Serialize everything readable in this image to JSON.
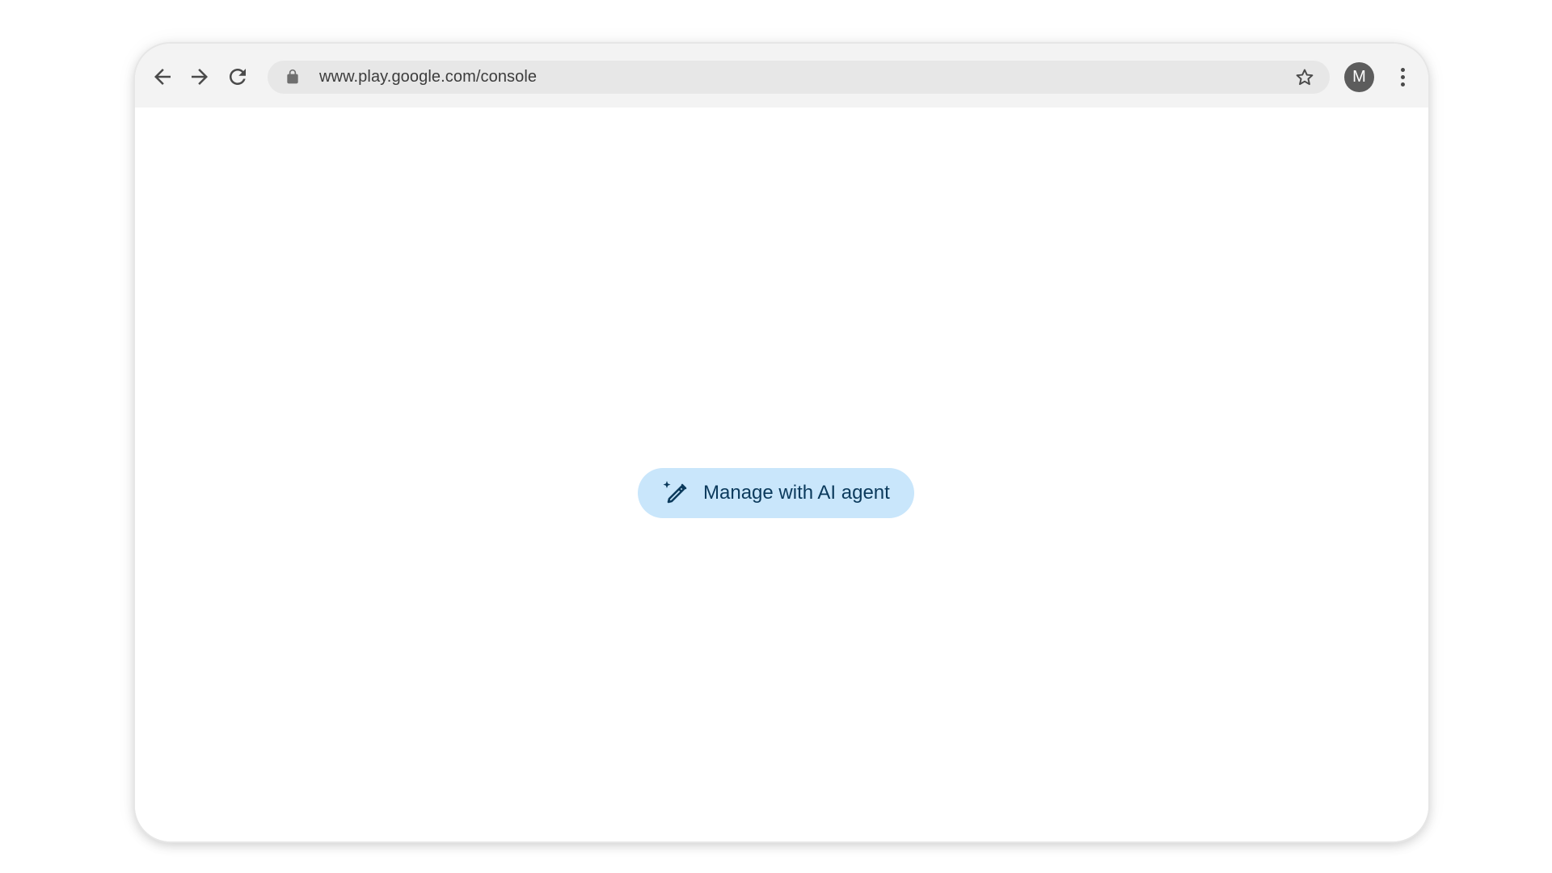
{
  "browser": {
    "url": "www.play.google.com/console",
    "profile_initial": "M"
  },
  "icons": {
    "back": "arrow-back-icon",
    "forward": "arrow-forward-icon",
    "reload": "reload-icon",
    "lock": "lock-icon",
    "bookmark": "star-icon",
    "menu": "more-vert-icon",
    "ai": "magic-pen-icon"
  },
  "main": {
    "ai_button_label": "Manage with AI agent"
  },
  "colors": {
    "toolbar_bg": "#f3f3f3",
    "omnibox_bg": "#e7e7e7",
    "ai_button_bg": "#c9e6fb",
    "ai_button_text": "#0b3a5c",
    "avatar_bg": "#5c5c5c"
  }
}
